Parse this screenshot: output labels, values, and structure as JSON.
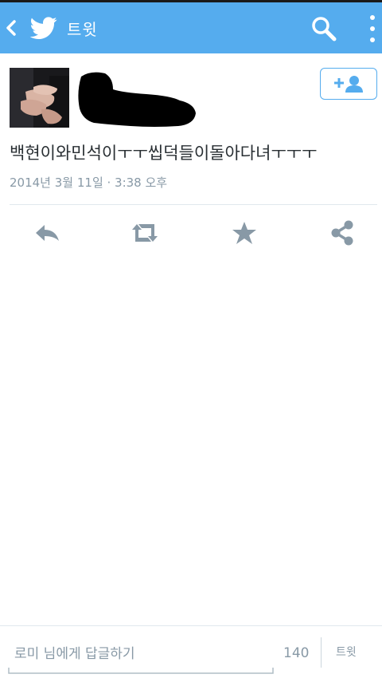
{
  "appbar": {
    "title": "트윗",
    "icons": [
      "back-arrow-icon",
      "twitter-bird-icon",
      "search-icon",
      "overflow-menu-icon"
    ]
  },
  "tweet": {
    "text": "백현이와민석이ㅜㅜ씹덕들이돌아다녀ㅜㅜㅜ",
    "timestamp": "2014년 3월 11일 · 3:38 오후",
    "author_name_redacted": true
  },
  "actions": [
    "reply-icon",
    "retweet-icon",
    "favorite-star-icon",
    "share-icon"
  ],
  "colors": {
    "brand": "#55acee",
    "icon_gray": "#8899a6",
    "text": "#292f33",
    "divider": "#e1e8ed"
  },
  "reply_bar": {
    "placeholder": "로미 님에게 답글하기",
    "char_count": "140",
    "tweet_button": "트윗"
  }
}
